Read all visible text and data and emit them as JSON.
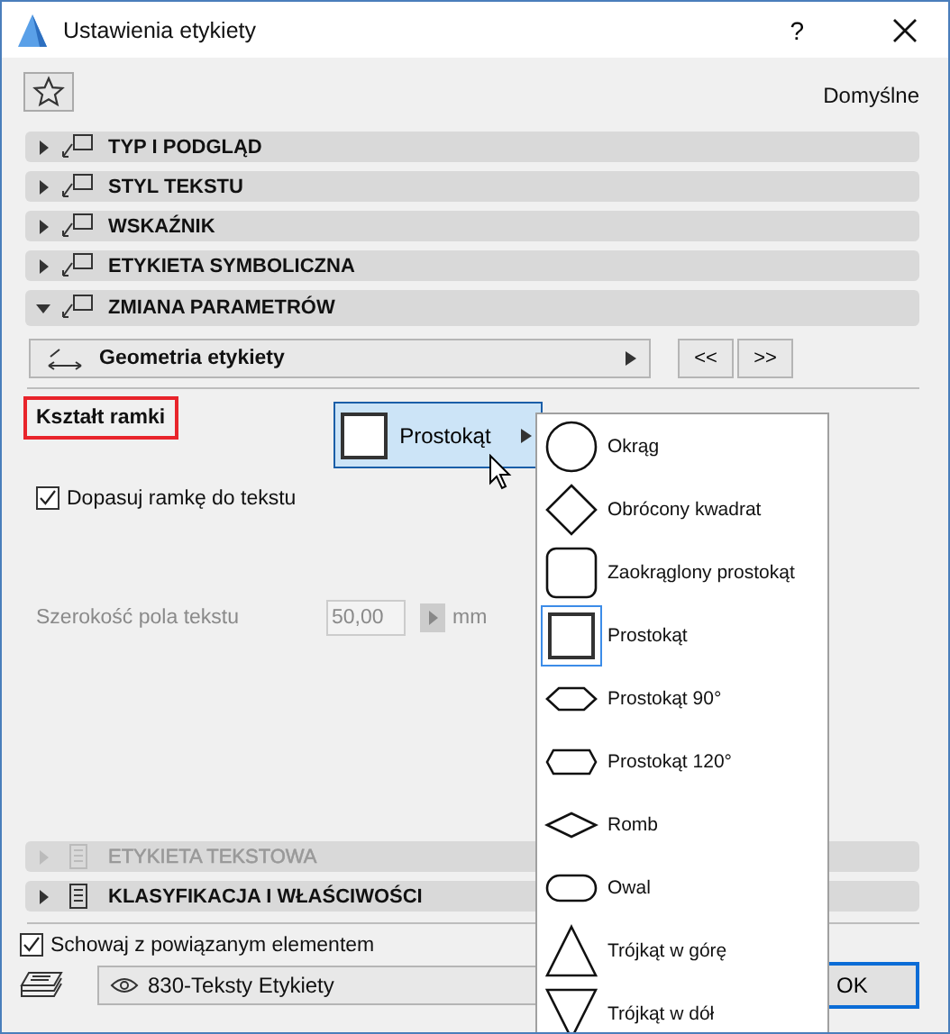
{
  "window": {
    "title": "Ustawienia etykiety",
    "help": "?"
  },
  "favorites_label": "Domyślne",
  "sections": [
    {
      "title": "TYP I PODGLĄD",
      "expanded": false,
      "disabled": false
    },
    {
      "title": "STYL TEKSTU",
      "expanded": false,
      "disabled": false
    },
    {
      "title": "WSKAŹNIK",
      "expanded": false,
      "disabled": false
    },
    {
      "title": "ETYKIETA SYMBOLICZNA",
      "expanded": false,
      "disabled": false
    },
    {
      "title": "ZMIANA PARAMETRÓW",
      "expanded": true,
      "disabled": false
    }
  ],
  "panel": {
    "page": "Geometria etykiety",
    "prev": "<<",
    "next": ">>"
  },
  "frame_shape": {
    "label": "Kształt ramki",
    "value": "Prostokąt"
  },
  "fit_checkbox": {
    "label": "Dopasuj ramkę do tekstu",
    "checked": true
  },
  "text_width": {
    "label": "Szerokość pola tekstu",
    "value": "50,00",
    "unit": "mm",
    "disabled": true
  },
  "lower_sections": [
    {
      "title": "ETYKIETA TEKSTOWA",
      "expanded": false,
      "disabled": true
    },
    {
      "title": "KLASYFIKACJA I WŁAŚCIWOŚCI",
      "expanded": false,
      "disabled": false
    }
  ],
  "hide_checkbox": {
    "label": "Schowaj z powiązanym elementem",
    "checked": true
  },
  "layer": {
    "value": "830-Teksty Etykiety"
  },
  "ok_button": "OK",
  "shape_menu": [
    {
      "label": "Okrąg",
      "kind": "circle",
      "selected": false
    },
    {
      "label": "Obrócony kwadrat",
      "kind": "diamond",
      "selected": false
    },
    {
      "label": "Zaokrąglony prostokąt",
      "kind": "rounded",
      "selected": false
    },
    {
      "label": "Prostokąt",
      "kind": "rect",
      "selected": true
    },
    {
      "label": "Prostokąt 90°",
      "kind": "hex90",
      "selected": false
    },
    {
      "label": "Prostokąt 120°",
      "kind": "hex120",
      "selected": false
    },
    {
      "label": "Romb",
      "kind": "rhombus",
      "selected": false
    },
    {
      "label": "Owal",
      "kind": "oval",
      "selected": false
    },
    {
      "label": "Trójkąt w górę",
      "kind": "triangle-up",
      "selected": false
    },
    {
      "label": "Trójkąt w dół",
      "kind": "triangle-down",
      "selected": false
    }
  ]
}
